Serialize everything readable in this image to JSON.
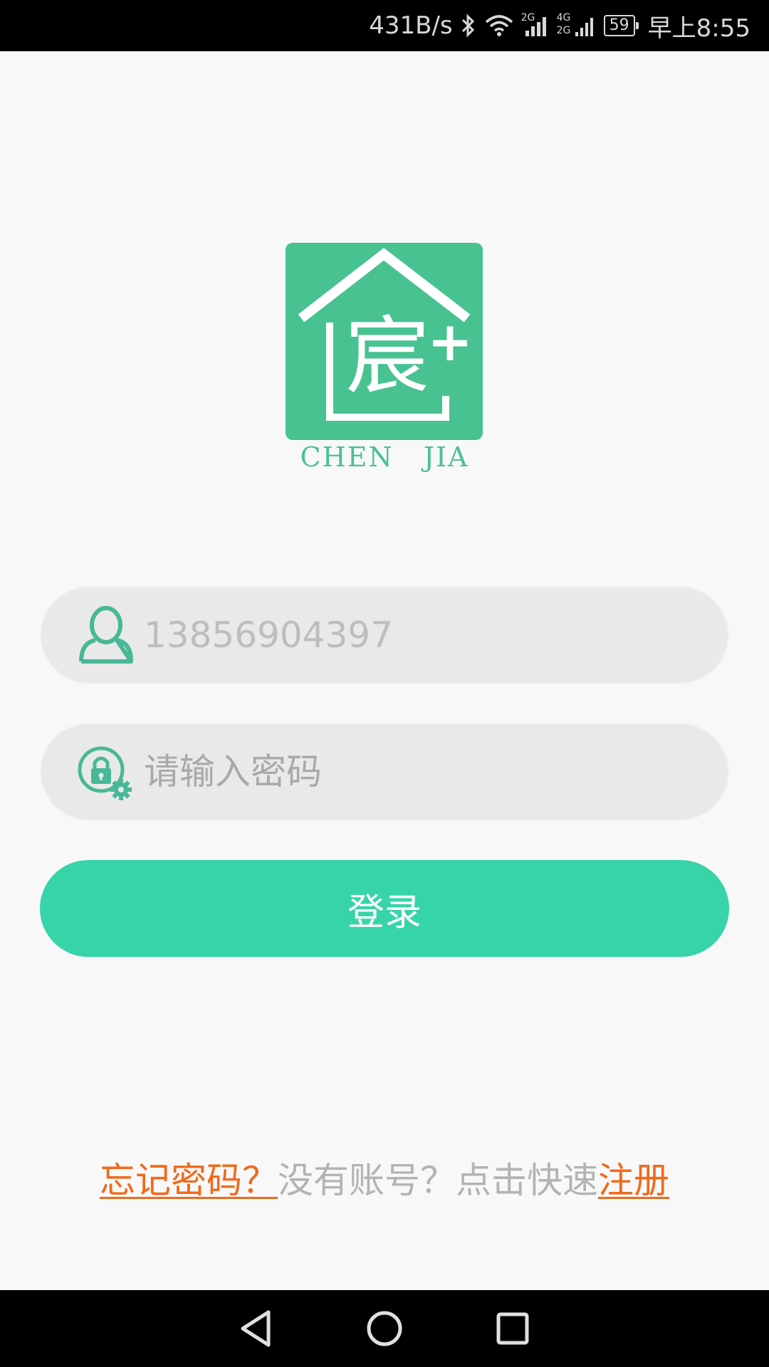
{
  "status_bar": {
    "net_speed": "431B/s",
    "signal_2g_label": "2G",
    "signal_4g_label": "4G",
    "signal_4g_sub_label": "2G",
    "battery": "59",
    "time": "早上8:55",
    "icons": [
      "bluetooth-icon",
      "wifi-icon",
      "signal-icon",
      "signal-4g-icon",
      "battery-icon"
    ]
  },
  "logo": {
    "character": "宸",
    "plus": "+",
    "caption_part1": "CHEN",
    "caption_part2": "JIA",
    "brand_color": "#48c291"
  },
  "form": {
    "phone_placeholder": "13856904397",
    "password_placeholder": "请输入密码",
    "login_label": "登录",
    "user_icon": "user-icon",
    "password_icon": "lock-gear-icon",
    "button_color": "#37d4a8"
  },
  "links": {
    "forgot_password": "忘记密码？",
    "no_account": "没有账号？点击快速",
    "register": "注册",
    "link_color": "#f06a1b"
  },
  "nav_bar": {
    "icons": [
      "back-icon",
      "home-icon",
      "recents-icon"
    ]
  }
}
